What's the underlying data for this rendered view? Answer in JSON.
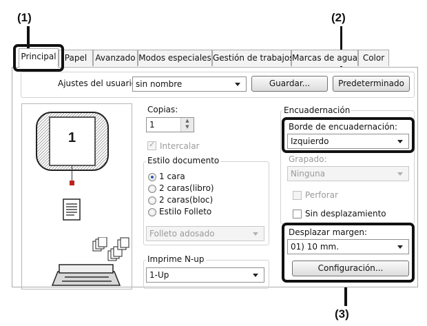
{
  "callouts": [
    "(1)",
    "(2)",
    "(3)"
  ],
  "tabs": [
    "Principal",
    "Papel",
    "Avanzado",
    "Modos especiales",
    "Gestión de trabajos",
    "Marcas de agua",
    "Color"
  ],
  "user_settings": {
    "label": "Ajustes del usuario:",
    "value": "sin nombre",
    "save_button": "Guardar...",
    "default_button": "Predeterminado"
  },
  "preview": {
    "page_number": "1"
  },
  "copies": {
    "label": "Copias:",
    "value": "1",
    "collate_label": "Intercalar"
  },
  "document_style": {
    "title": "Estilo documento",
    "options": [
      "1 cara",
      "2 caras(libro)",
      "2 caras(bloc)",
      "Estilo Folleto"
    ],
    "selected": "1 cara",
    "booklet_select": "Folleto adosado"
  },
  "n_up": {
    "title": "Imprime N-up",
    "value": "1-Up"
  },
  "binding": {
    "group_title": "Encuadernación",
    "edge_label": "Borde de encuadernación:",
    "edge_value": "Izquierdo",
    "stapling_label": "Grapado:",
    "stapling_value": "Ninguna",
    "punch_label": "Perforar",
    "no_offset_label": "Sin desplazamiento"
  },
  "margin_shift": {
    "label": "Desplazar margen:",
    "value": "01) 10 mm.",
    "config_button": "Configuración..."
  },
  "colors": {
    "highlight": "#111111",
    "accent_radio": "#2b55a8"
  }
}
